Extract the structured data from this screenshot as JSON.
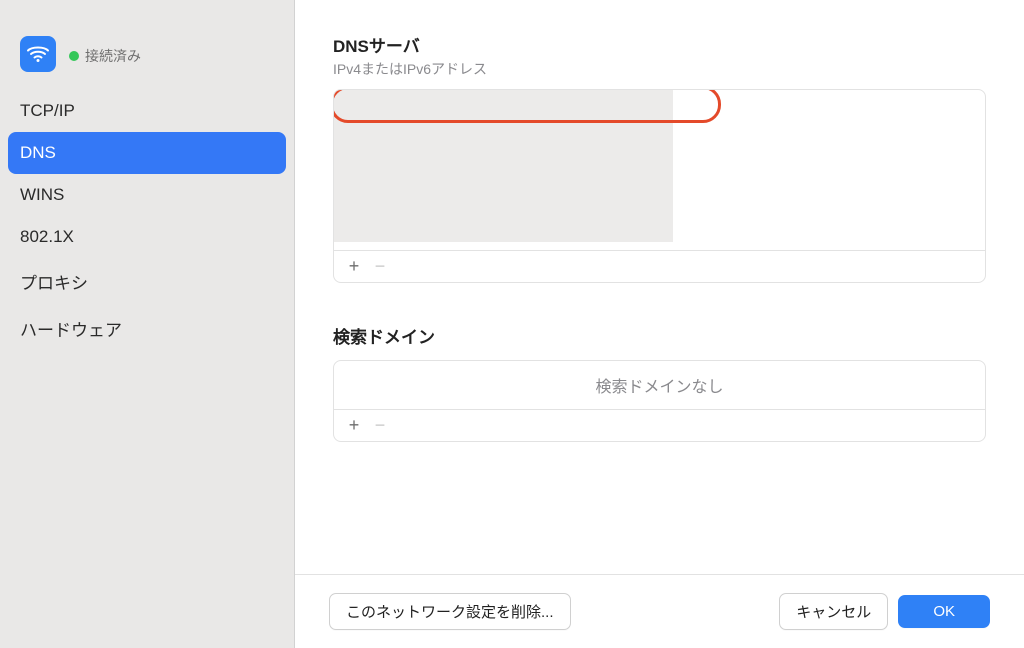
{
  "sidebar": {
    "connection_status": "接続済み",
    "items": [
      {
        "label": "TCP/IP",
        "selected": false
      },
      {
        "label": "DNS",
        "selected": true
      },
      {
        "label": "WINS",
        "selected": false
      },
      {
        "label": "802.1X",
        "selected": false
      },
      {
        "label": "プロキシ",
        "selected": false
      },
      {
        "label": "ハードウェア",
        "selected": false
      }
    ]
  },
  "dns": {
    "title": "DNSサーバ",
    "subtitle": "IPv4またはIPv6アドレス",
    "rows": [
      {
        "value": ""
      },
      {
        "value": ""
      }
    ],
    "add_label": "+",
    "remove_label": "−"
  },
  "search": {
    "title": "検索ドメイン",
    "empty_text": "検索ドメインなし",
    "add_label": "+",
    "remove_label": "−"
  },
  "footer": {
    "delete_label": "このネットワーク設定を削除...",
    "cancel_label": "キャンセル",
    "ok_label": "OK"
  },
  "colors": {
    "accent": "#2f81f6",
    "highlight_ring": "#e44a2a",
    "status_dot": "#34c759"
  }
}
